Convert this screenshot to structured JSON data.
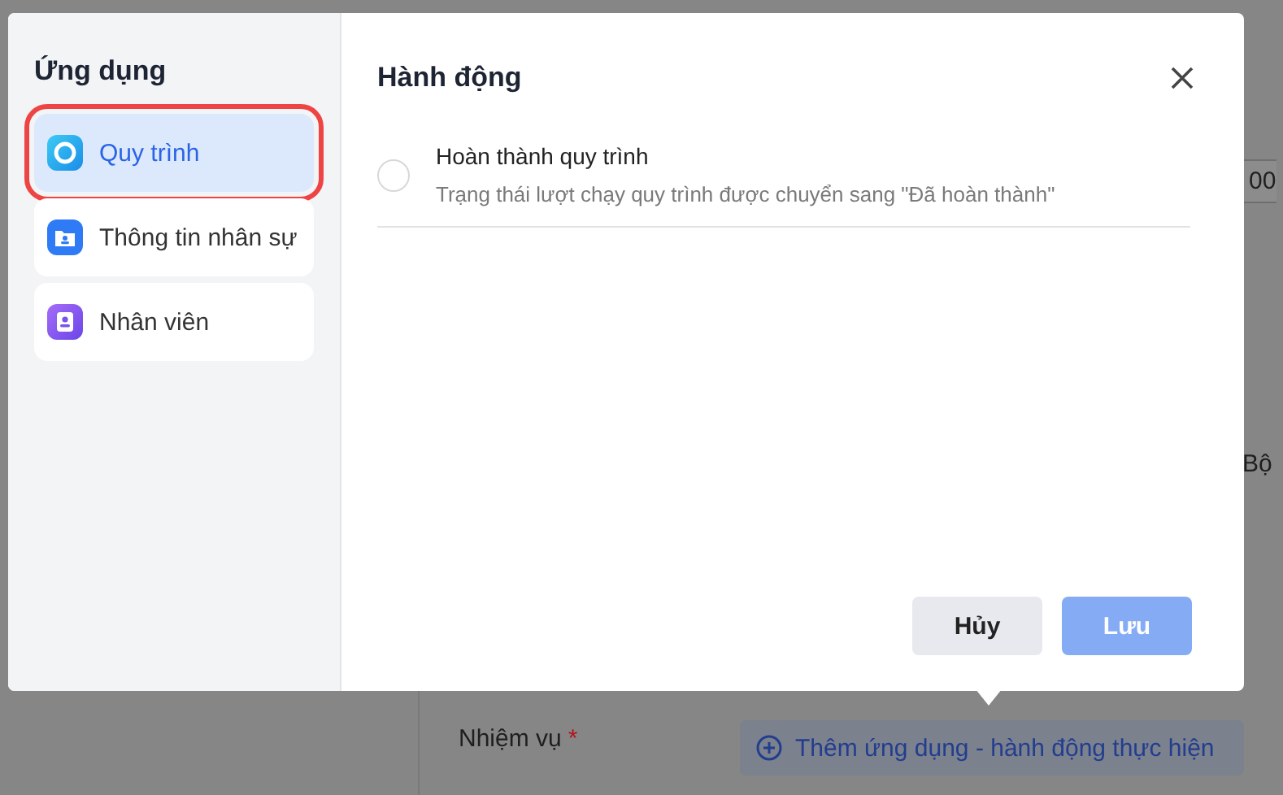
{
  "background": {
    "fragments": [
      {
        "text": "00",
        "kind": "field"
      },
      {
        "text": "Bộ",
        "kind": "text"
      }
    ],
    "task_label": "Nhiệm vụ",
    "required_mark": "*",
    "add_button": "Thêm ứng dụng - hành động thực hiện"
  },
  "dialog": {
    "sidebar": {
      "title": "Ứng dụng",
      "items": [
        {
          "label": "Quy trình",
          "kind": "process",
          "selected": true
        },
        {
          "label": "Thông tin nhân sự",
          "kind": "hr",
          "selected": false
        },
        {
          "label": "Nhân viên",
          "kind": "employee",
          "selected": false
        }
      ]
    },
    "title": "Hành động",
    "actions": [
      {
        "title": "Hoàn thành quy trình",
        "description": "Trạng thái lượt chạy quy trình được chuyển sang \"Đã hoàn thành\"",
        "selected": false
      }
    ],
    "buttons": [
      {
        "label": "Hủy",
        "kind": "secondary",
        "disabled": false
      },
      {
        "label": "Lưu",
        "kind": "primary",
        "disabled": true
      }
    ]
  }
}
